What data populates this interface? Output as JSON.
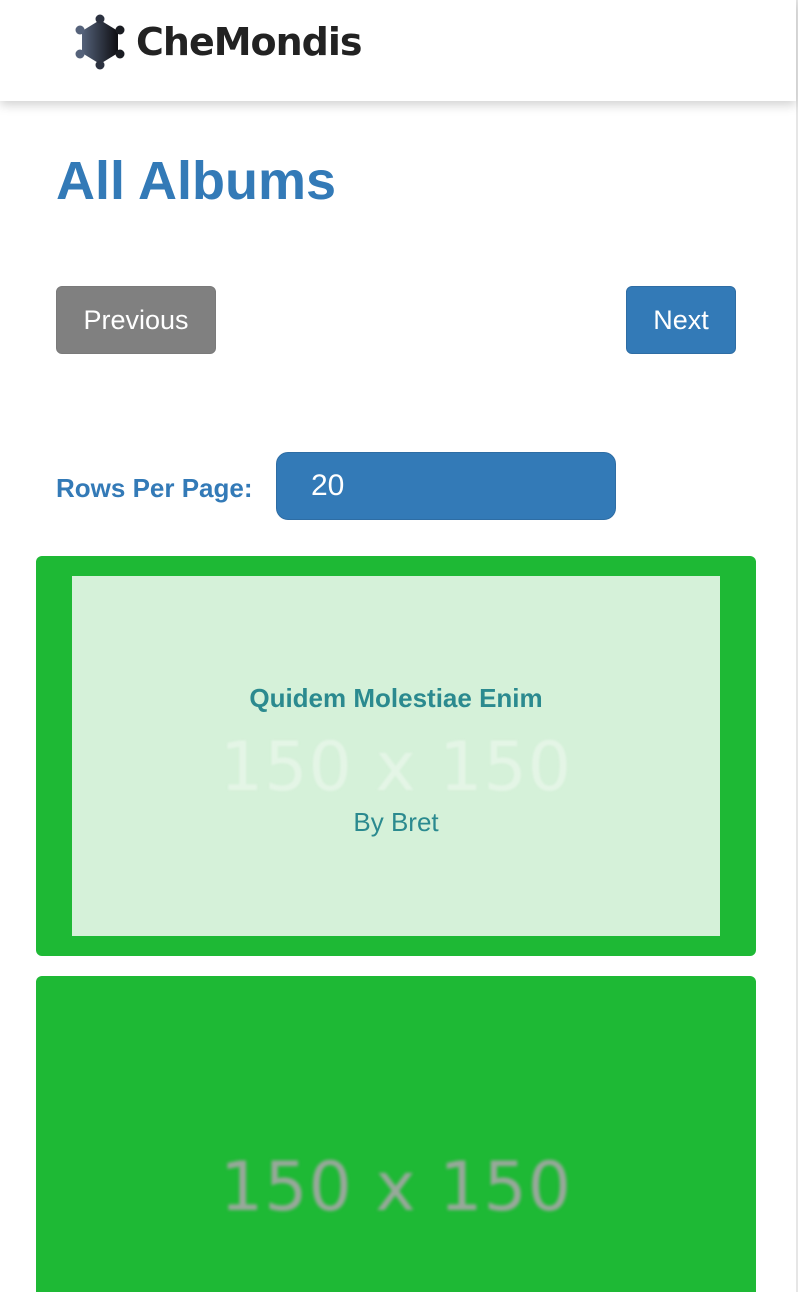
{
  "header": {
    "brand": "CheMondis",
    "logo_icon": "hexagon-molecule-icon"
  },
  "main": {
    "title": "All Albums",
    "pagination": {
      "previous_label": "Previous",
      "next_label": "Next"
    },
    "rows_per_page": {
      "label": "Rows Per Page:",
      "value": "20"
    },
    "albums": [
      {
        "title": "Quidem Molestiae Enim",
        "author": "By Bret",
        "placeholder_text": "150 x 150"
      },
      {
        "placeholder_text": "150 x 150"
      }
    ]
  },
  "colors": {
    "accent": "#337ab7",
    "disabled": "#808080",
    "card": "#1eb935",
    "card_overlay": "#d5f1d9",
    "album_text": "#2b8a8f"
  }
}
